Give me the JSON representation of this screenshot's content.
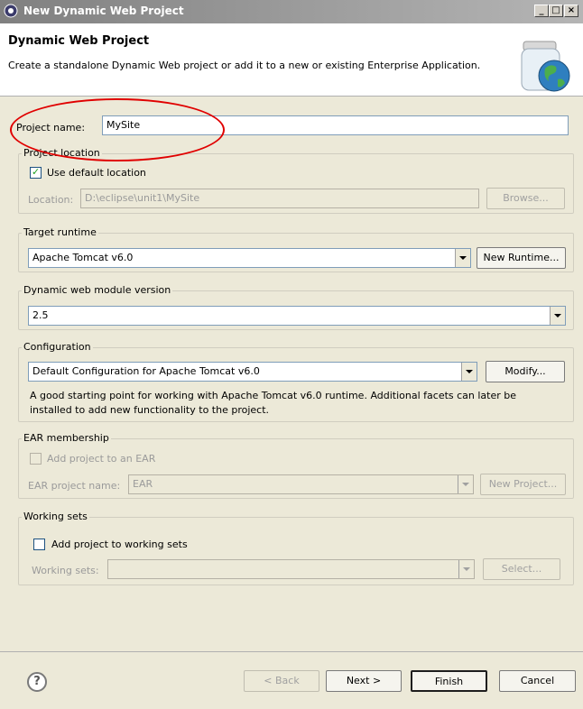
{
  "window": {
    "title": "New Dynamic Web Project",
    "minimize": "_",
    "maximize": "□",
    "close": "×"
  },
  "header": {
    "title": "Dynamic Web Project",
    "description": "Create a standalone Dynamic Web project or add it to a new or existing Enterprise Application."
  },
  "project_name": {
    "label": "Project name:",
    "value": "MySite"
  },
  "project_location": {
    "group_label": "Project location",
    "use_default_label": "Use default location",
    "use_default_checked": true,
    "location_label": "Location:",
    "location_value": "D:\\eclipse\\unit1\\MySite",
    "browse_label": "Browse..."
  },
  "target_runtime": {
    "group_label": "Target runtime",
    "selected": "Apache Tomcat v6.0",
    "new_runtime_label": "New Runtime..."
  },
  "module_version": {
    "group_label": "Dynamic web module version",
    "selected": "2.5"
  },
  "configuration": {
    "group_label": "Configuration",
    "selected": "Default Configuration for Apache Tomcat v6.0",
    "modify_label": "Modify...",
    "description_line1": "A good starting point for working with Apache Tomcat v6.0 runtime. Additional facets can later be",
    "description_line2": "installed to add new functionality to the project."
  },
  "ear_membership": {
    "group_label": "EAR membership",
    "add_label": "Add project to an EAR",
    "add_checked": false,
    "ear_name_label": "EAR project name:",
    "ear_name_value": "EAR",
    "new_project_label": "New Project..."
  },
  "working_sets": {
    "group_label": "Working sets",
    "add_label": "Add project to working sets",
    "add_checked": false,
    "sets_label": "Working sets:",
    "sets_value": "",
    "select_label": "Select..."
  },
  "footer": {
    "help_glyph": "?",
    "back_label": "< Back",
    "next_label": "Next >",
    "finish_label": "Finish",
    "cancel_label": "Cancel"
  },
  "annotation_color": "#e00000",
  "icons": {
    "app": "eclipse-icon",
    "header": "jar-globe-icon",
    "help": "help-icon"
  }
}
